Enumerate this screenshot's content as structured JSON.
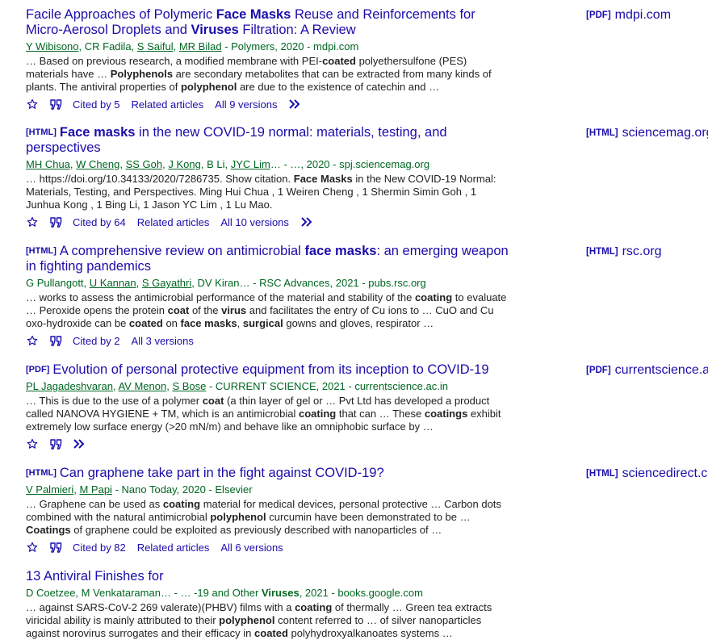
{
  "results": [
    {
      "tag": "",
      "title_html": "Facile Approaches of Polymeric <b>Face Masks</b> Reuse and Reinforcements for Micro-Aerosol Droplets and <b>Viruses</b> Filtration: A Review",
      "authors": [
        {
          "name": "Y Wibisono",
          "link": true
        },
        {
          "name": "CR Fadila",
          "link": false
        },
        {
          "name": "S Saiful",
          "link": true
        },
        {
          "name": "MR Bilad",
          "link": true
        }
      ],
      "source": " - Polymers, 2020 - mdpi.com",
      "snippet_html": "… Based on previous research, a modified membrane with PEI-<b>coated</b> polyethersulfone (PES) materials have … <b>Polyphenols</b> are secondary metabolites that can be extracted from many kinds of plants. The antiviral properties of <b>polyphenol</b> are due to the existence of catechin and …",
      "cited_by": "Cited by 5",
      "related": "Related articles",
      "versions": "All 9 versions",
      "more": true,
      "side_tag": "[PDF]",
      "side_domain": "mdpi.com"
    },
    {
      "tag": "[HTML]",
      "title_html": "<b>Face masks</b> in the new COVID-19 normal: materials, testing, and perspectives",
      "authors": [
        {
          "name": "MH Chua",
          "link": true
        },
        {
          "name": "W Cheng",
          "link": true
        },
        {
          "name": "SS Goh",
          "link": true
        },
        {
          "name": "J Kong",
          "link": true
        },
        {
          "name": "B Li",
          "link": false
        },
        {
          "name": "JYC Lim",
          "link": true
        }
      ],
      "source": "… - …, 2020 - spj.sciencemag.org",
      "snippet_html": "… https://doi.org/10.34133/2020/7286735. Show citation. <b>Face Masks</b> in the New COVID-19 Normal: Materials, Testing, and Perspectives. Ming Hui Chua , 1 Weiren Cheng , 1 Shermin Simin Goh , 1 Junhua Kong , 1 Bing Li, 1 Jason YC Lim , 1 Lu Mao.",
      "cited_by": "Cited by 64",
      "related": "Related articles",
      "versions": "All 10 versions",
      "more": true,
      "side_tag": "[HTML]",
      "side_domain": "sciencemag.org"
    },
    {
      "tag": "[HTML]",
      "title_html": "A comprehensive review on antimicrobial <b>face masks</b>: an emerging weapon in fighting pandemics",
      "authors": [
        {
          "name": "G Pullangott",
          "link": false
        },
        {
          "name": "U Kannan",
          "link": true
        },
        {
          "name": "S Gayathri",
          "link": true
        },
        {
          "name": "DV Kiran",
          "link": false
        }
      ],
      "source": "… - RSC Advances, 2021 - pubs.rsc.org",
      "snippet_html": "… works to assess the antimicrobial performance of the material and stability of the <b>coating</b> to evaluate … Peroxide opens the protein <b>coat</b> of the <b>virus</b> and facilitates the entry of Cu ions to … CuO and Cu oxo-hydroxide can be <b>coated</b> on <b>face masks</b>, <b>surgical</b> gowns and gloves, respirator …",
      "cited_by": "Cited by 2",
      "related": "",
      "versions": "All 3 versions",
      "more": false,
      "side_tag": "[HTML]",
      "side_domain": "rsc.org"
    },
    {
      "tag": "[PDF]",
      "title_html": "Evolution of personal protective equipment from its inception to COVID-19",
      "authors": [
        {
          "name": "PL Jagadeshvaran",
          "link": true
        },
        {
          "name": "AV Menon",
          "link": true
        },
        {
          "name": "S Bose",
          "link": true
        }
      ],
      "source": " - CURRENT SCIENCE, 2021 - currentscience.ac.in",
      "snippet_html": "… This is due to the use of a polymer <b>coat</b> (a thin layer of gel or … Pvt Ltd has developed a product called NANOVA HYGIENE + TM, which is an antimicrobial <b>coating</b> that can … These <b>coatings</b> exhibit extremely low surface energy (&gt;20 mN/m) and behave like an omniphobic surface by …",
      "cited_by": "",
      "related": "",
      "versions": "",
      "more": true,
      "side_tag": "[PDF]",
      "side_domain": "currentscience.ac.in"
    },
    {
      "tag": "[HTML]",
      "title_html": "Can graphene take part in the fight against COVID-19?",
      "authors": [
        {
          "name": "V Palmieri",
          "link": true
        },
        {
          "name": "M Papi",
          "link": true
        }
      ],
      "source": " - Nano Today, 2020 - Elsevier",
      "snippet_html": "… Graphene can be used as <b>coating</b> material for medical devices, personal protective … Carbon dots combined with the natural antimicrobial <b>polyphenol</b> curcumin have been demonstrated to be … <b>Coatings</b> of graphene could be exploited as previously described with nanoparticles of …",
      "cited_by": "Cited by 82",
      "related": "Related articles",
      "versions": "All 6 versions",
      "more": false,
      "side_tag": "[HTML]",
      "side_domain": "sciencedirect.com"
    },
    {
      "tag": "",
      "title_html": "13 Antiviral Finishes for",
      "authors": [
        {
          "name": "D Coetzee",
          "link": false
        },
        {
          "name": "M Venkataraman",
          "link": false
        }
      ],
      "source": "… - … -19 and Other <b>Viruses</b>, 2021 - books.google.com",
      "snippet_html": "… against SARS-CoV-2 269 valerate)(PHBV) films with a <b>coating</b> of thermally … Green tea extracts viricidal ability is mainly attributed to their <b>polyphenol</b> content referred to … of silver nanoparticles against norovirus surrogates and their efficacy in <b>coated</b> polyhydroxyalkanoates systems …",
      "cited_by": "",
      "related": "",
      "versions": "",
      "more": false,
      "side_tag": "",
      "side_domain": ""
    }
  ]
}
